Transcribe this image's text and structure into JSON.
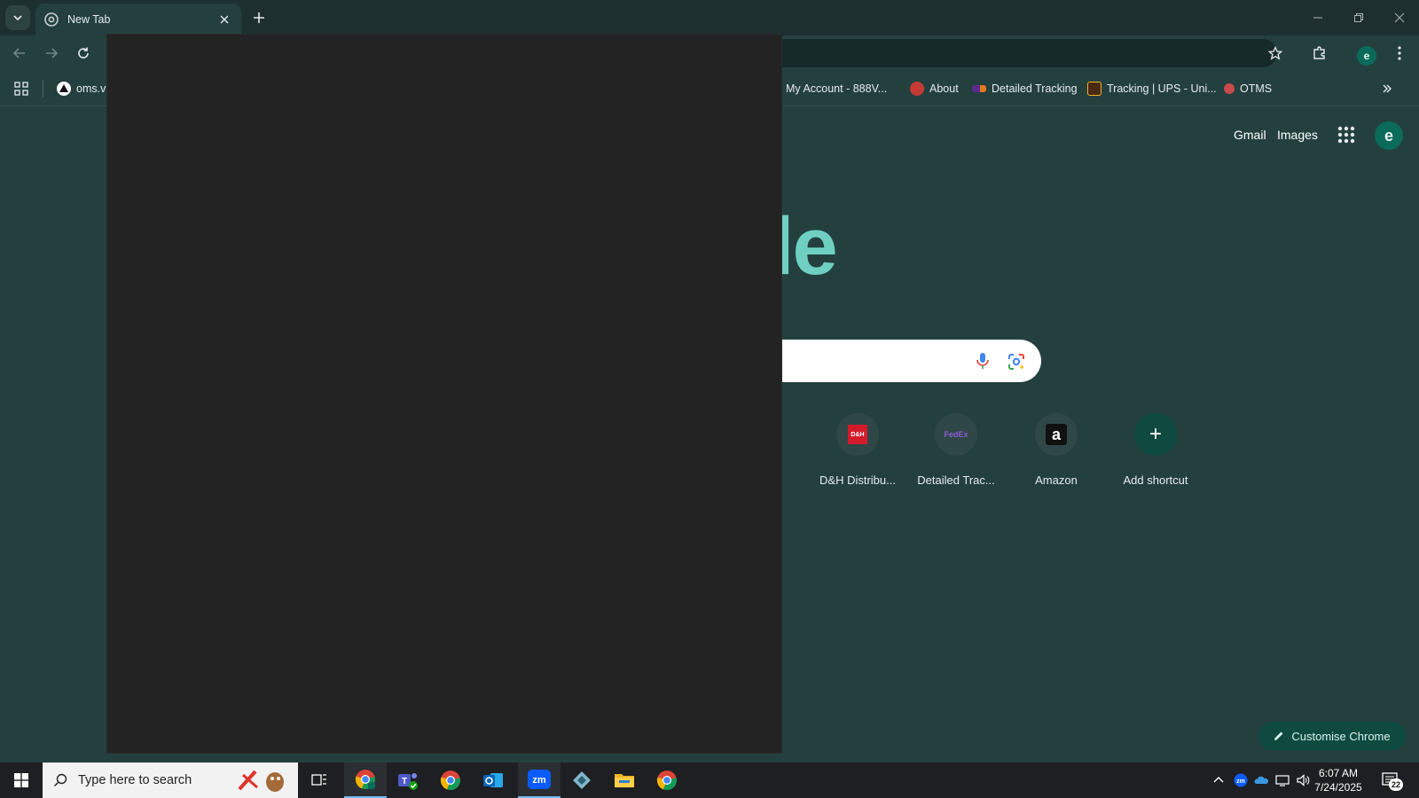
{
  "browser": {
    "tab_title": "New Tab",
    "window_controls": [
      "minimize-icon",
      "restore-icon",
      "close-icon"
    ]
  },
  "bookmarks": [
    {
      "label": "oms.v",
      "icon": "triangle-logo"
    },
    {
      "label": "My Account - 888V...",
      "icon": "site-favicon"
    },
    {
      "label": "About",
      "icon": "site-favicon"
    },
    {
      "label": "Detailed Tracking",
      "icon": "fedex-favicon"
    },
    {
      "label": "Tracking | UPS - Uni...",
      "icon": "ups-favicon"
    },
    {
      "label": "OTMS",
      "icon": "site-favicon"
    }
  ],
  "ntp": {
    "gmail": "Gmail",
    "images": "Images",
    "avatar_letter": "e",
    "logo_visible": "le",
    "shortcuts": [
      {
        "label": "D&H Distribu...",
        "icon_text": "D&H"
      },
      {
        "label": "Detailed Trac...",
        "icon_text": "FedEx"
      },
      {
        "label": "Amazon",
        "icon_text": "a"
      },
      {
        "label": "Add shortcut",
        "icon_text": "+"
      }
    ],
    "customise": "Customise Chrome"
  },
  "taskbar": {
    "search_placeholder": "Type here to search",
    "time": "6:07 AM",
    "date": "7/24/2025",
    "notification_count": "22"
  },
  "colors": {
    "background": "#23403f",
    "accent": "#6fd0c2",
    "overlay": "#232323"
  }
}
